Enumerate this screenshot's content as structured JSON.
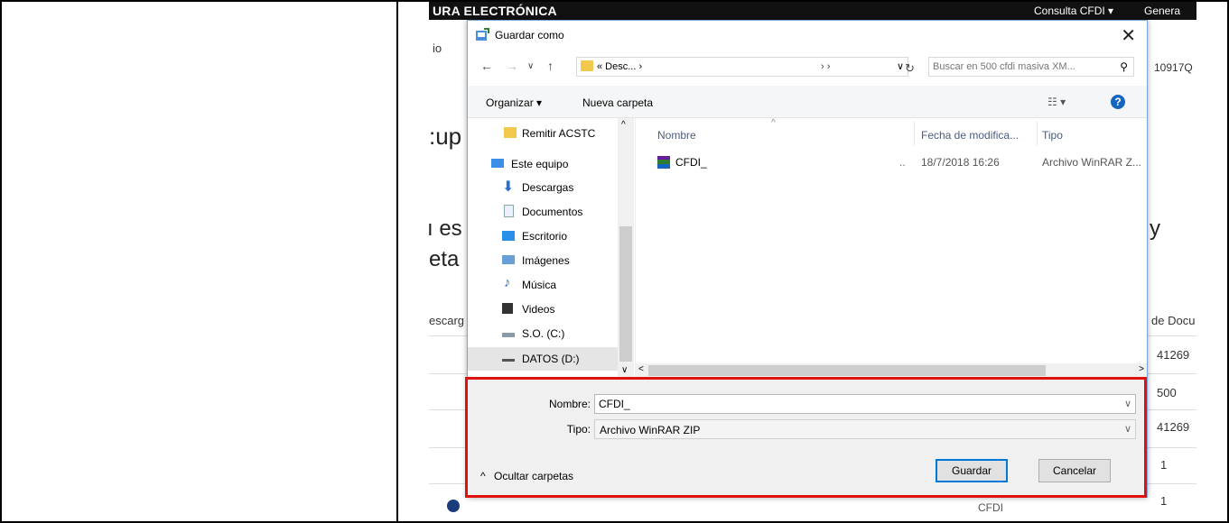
{
  "background_page": {
    "header_title": "URA ELECTRÓNICA",
    "nav_consulta": "Consulta CFDI ▾",
    "nav_genera": "Genera",
    "frag_io": "io",
    "frag_10917": "10917Q",
    "frag_cup": ":up",
    "frag_es": "ı es",
    "frag_y": "y",
    "frag_eta": "eta",
    "frag_escarg": "escarg",
    "frag_de_docu": "de Docu",
    "frag_41269_a": "41269",
    "frag_500": "500",
    "frag_41269_b": "41269",
    "frag_1_a": "1",
    "frag_1_b": "1",
    "frag_cfdi": "CFDI"
  },
  "dialog": {
    "title": "Guardar como",
    "address": {
      "path": "« Desc... ›",
      "segment_arrow": "› ›"
    },
    "search_placeholder": "Buscar en 500 cfdi masiva XM...",
    "toolbar": {
      "organize": "Organizar ▾",
      "new_folder": "Nueva carpeta"
    },
    "nav_items": [
      {
        "label": "Remitir ACSTC"
      },
      {
        "label": "Este equipo"
      },
      {
        "label": "Descargas"
      },
      {
        "label": "Documentos"
      },
      {
        "label": "Escritorio"
      },
      {
        "label": "Imágenes"
      },
      {
        "label": "Música"
      },
      {
        "label": "Videos"
      },
      {
        "label": "S.O. (C:)"
      },
      {
        "label": "DATOS (D:)"
      }
    ],
    "columns": {
      "name": "Nombre",
      "date": "Fecha de modifica...",
      "type": "Tipo"
    },
    "files": [
      {
        "name": "CFDI_",
        "ellipsis": "..",
        "date": "18/7/2018 16:26",
        "type": "Archivo WinRAR Z..."
      }
    ],
    "save": {
      "name_label": "Nombre:",
      "name_value": "CFDI_",
      "type_label": "Tipo:",
      "type_value": "Archivo WinRAR ZIP",
      "hide_folders": "Ocultar carpetas",
      "save_button": "Guardar",
      "cancel_button": "Cancelar"
    }
  },
  "colors": {
    "highlight": "#e01010",
    "accent": "#0078d7"
  }
}
